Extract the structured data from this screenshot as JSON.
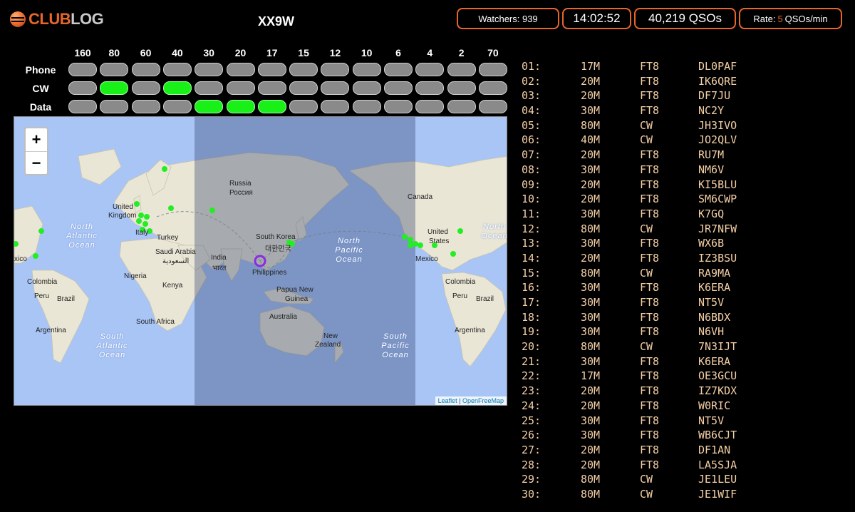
{
  "header": {
    "logo_part1": "CLUB",
    "logo_part2": "LOG",
    "callsign": "XX9W",
    "watchers": "Watchers: 939",
    "time": "14:02:52",
    "qsos": "40,219 QSOs",
    "rate_prefix": "Rate:",
    "rate_value": "5",
    "rate_suffix": "QSOs/min"
  },
  "bands": {
    "headers": [
      "160",
      "80",
      "60",
      "40",
      "30",
      "20",
      "17",
      "15",
      "12",
      "10",
      "6",
      "4",
      "2",
      "70"
    ],
    "rows": [
      {
        "label": "Phone",
        "active": [
          0,
          0,
          0,
          0,
          0,
          0,
          0,
          0,
          0,
          0,
          0,
          0,
          0,
          0
        ]
      },
      {
        "label": "CW",
        "active": [
          0,
          1,
          0,
          1,
          0,
          0,
          0,
          0,
          0,
          0,
          0,
          0,
          0,
          0
        ]
      },
      {
        "label": "Data",
        "active": [
          0,
          0,
          0,
          0,
          1,
          1,
          1,
          0,
          0,
          0,
          0,
          0,
          0,
          0
        ]
      }
    ]
  },
  "map": {
    "zoom_in": "+",
    "zoom_out": "−",
    "attribution_leaflet": "Leaflet",
    "attribution_sep": "|",
    "attribution_tiles": "OpenFreeMap",
    "labels": {
      "russia": "Russia",
      "russia_local": "Россия",
      "canada": "Canada",
      "uk": "United",
      "uk2": "Kingdom",
      "italy": "Italy",
      "turkey": "Turkey",
      "saudi": "Saudi Arabia",
      "saudi_local": "السعودية",
      "india": "India",
      "india_local": "भारत",
      "skorea": "South Korea",
      "skorea_local": "대한민국",
      "philippines": "Philippines",
      "nigeria": "Nigeria",
      "kenya": "Kenya",
      "png1": "Papua New",
      "png2": "Guinea",
      "australia": "Australia",
      "safrica": "South Africa",
      "nz1": "New",
      "nz2": "Zealand",
      "colombia_l": "Colombia",
      "peru_l": "Peru",
      "brazil_l": "Brazil",
      "argentina_l": "Argentina",
      "usa1": "United",
      "usa2": "States",
      "mexico": "Mexico",
      "colombia_r": "Colombia",
      "peru_r": "Peru",
      "brazil_r": "Brazil",
      "argentina_r": "Argentina",
      "mexico_l": "xico"
    },
    "oceans": {
      "north_atlantic_l": "North Atlantic Ocean",
      "north_pacific": "North Pacific Ocean",
      "south_atlantic_l": "South Atlantic Ocean",
      "south_pacific": "South Pacific Ocean",
      "north_atlantic_r": "North Ocean"
    }
  },
  "log": [
    {
      "num": "01:",
      "band": "17M",
      "mode": "FT8",
      "call": "DL0PAF"
    },
    {
      "num": "02:",
      "band": "20M",
      "mode": "FT8",
      "call": "IK6QRE"
    },
    {
      "num": "03:",
      "band": "20M",
      "mode": "FT8",
      "call": "DF7JU"
    },
    {
      "num": "04:",
      "band": "30M",
      "mode": "FT8",
      "call": "NC2Y"
    },
    {
      "num": "05:",
      "band": "80M",
      "mode": "CW",
      "call": "JH3IVO"
    },
    {
      "num": "06:",
      "band": "40M",
      "mode": "CW",
      "call": "JO2QLV"
    },
    {
      "num": "07:",
      "band": "20M",
      "mode": "FT8",
      "call": "RU7M"
    },
    {
      "num": "08:",
      "band": "30M",
      "mode": "FT8",
      "call": "NM6V"
    },
    {
      "num": "09:",
      "band": "20M",
      "mode": "FT8",
      "call": "KI5BLU"
    },
    {
      "num": "10:",
      "band": "20M",
      "mode": "FT8",
      "call": "SM6CWP"
    },
    {
      "num": "11:",
      "band": "30M",
      "mode": "FT8",
      "call": "K7GQ"
    },
    {
      "num": "12:",
      "band": "80M",
      "mode": "CW",
      "call": "JR7NFW"
    },
    {
      "num": "13:",
      "band": "30M",
      "mode": "FT8",
      "call": "WX6B"
    },
    {
      "num": "14:",
      "band": "20M",
      "mode": "FT8",
      "call": "IZ3BSU"
    },
    {
      "num": "15:",
      "band": "80M",
      "mode": "CW",
      "call": "RA9MA"
    },
    {
      "num": "16:",
      "band": "30M",
      "mode": "FT8",
      "call": "K6ERA"
    },
    {
      "num": "17:",
      "band": "30M",
      "mode": "FT8",
      "call": "NT5V"
    },
    {
      "num": "18:",
      "band": "30M",
      "mode": "FT8",
      "call": "N6BDX"
    },
    {
      "num": "19:",
      "band": "30M",
      "mode": "FT8",
      "call": "N6VH"
    },
    {
      "num": "20:",
      "band": "80M",
      "mode": "CW",
      "call": "7N3IJT"
    },
    {
      "num": "21:",
      "band": "30M",
      "mode": "FT8",
      "call": "K6ERA"
    },
    {
      "num": "22:",
      "band": "17M",
      "mode": "FT8",
      "call": "OE3GCU"
    },
    {
      "num": "23:",
      "band": "20M",
      "mode": "FT8",
      "call": "IZ7KDX"
    },
    {
      "num": "24:",
      "band": "20M",
      "mode": "FT8",
      "call": "W0RIC"
    },
    {
      "num": "25:",
      "band": "30M",
      "mode": "FT8",
      "call": "NT5V"
    },
    {
      "num": "26:",
      "band": "30M",
      "mode": "FT8",
      "call": "WB6CJT"
    },
    {
      "num": "27:",
      "band": "20M",
      "mode": "FT8",
      "call": "DF1AN"
    },
    {
      "num": "28:",
      "band": "20M",
      "mode": "FT8",
      "call": "LA5SJA"
    },
    {
      "num": "29:",
      "band": "80M",
      "mode": "CW",
      "call": "JE1LEU"
    },
    {
      "num": "30:",
      "band": "80M",
      "mode": "CW",
      "call": "JE1WIF"
    }
  ],
  "colors": {
    "accent": "#e8662a",
    "active_band": "#18f018",
    "inactive_band": "#8a8a8a",
    "log_text": "#f4cfa6",
    "spot": "#22ee22",
    "dxpedition_marker": "#8a2be2"
  }
}
